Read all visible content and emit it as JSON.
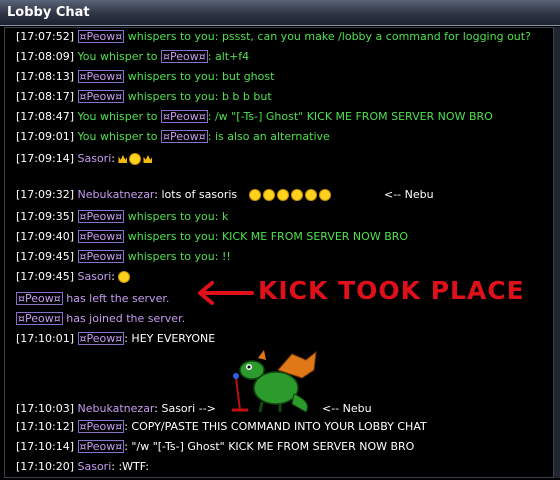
{
  "window": {
    "title": "Lobby Chat"
  },
  "users": {
    "peow": "¤Peow¤",
    "nebu": "Nebukatnezar",
    "sasori": "Sasori"
  },
  "messages": [
    {
      "ts": "[17:07:52]",
      "text": " whispers to you: pssst, can you make /lobby a command for logging out?"
    },
    {
      "ts": "[17:08:09]",
      "pre": " You whisper to ",
      "text": ": alt+f4"
    },
    {
      "ts": "[17:08:13]",
      "text": " whispers to you: but ghost"
    },
    {
      "ts": "[17:08:17]",
      "text": " whispers to you: b b b but"
    },
    {
      "ts": "[17:08:47]",
      "pre": " You whisper to ",
      "text": ":  /w \"[-Ts-] Ghost\" KICK ME FROM SERVER NOW BRO"
    },
    {
      "ts": "[17:09:01]",
      "pre": " You whisper to ",
      "text": ": is also an alternative"
    },
    {
      "ts": "[17:09:14]",
      "text": ":"
    },
    {
      "ts": "[17:09:32]",
      "text": ": lots of sasoris"
    },
    {
      "ts": "[17:09:35]",
      "text": " whispers to you: k"
    },
    {
      "ts": "[17:09:40]",
      "text": " whispers to you: KICK ME FROM SERVER NOW BRO"
    },
    {
      "ts": "[17:09:45]",
      "text": " whispers to you: !!"
    },
    {
      "ts": "[17:09:45]",
      "text": ":"
    },
    {
      "ts": "",
      "text": " has left the server."
    },
    {
      "ts": "",
      "text": " has joined the server."
    },
    {
      "ts": "[17:10:01]",
      "text": ": HEY EVERYONE"
    },
    {
      "ts": "[17:10:03]",
      "text": ": Sasori -->"
    },
    {
      "ts": "[17:10:12]",
      "text": ": COPY/PASTE THIS COMMAND INTO YOUR LOBBY CHAT"
    },
    {
      "ts": "[17:10:14]",
      "text": ": \"/w \"[-Ts-] Ghost\" KICK ME FROM SERVER NOW BRO"
    },
    {
      "ts": "[17:10:20]",
      "text": ": :WTF:"
    }
  ],
  "notes": {
    "nebu1": "<-- Nebu",
    "nebu2": "<-- Nebu",
    "kick": "KICK TOOK PLACE"
  },
  "colors": {
    "green": "#4ee04e",
    "purple": "#c79cf0",
    "red_ink": "#e0101a",
    "title_bg": "#2e3444"
  },
  "icons": [
    "smiley-icon",
    "crown-icon",
    "dragon-image",
    "red-arrow-annotation"
  ]
}
